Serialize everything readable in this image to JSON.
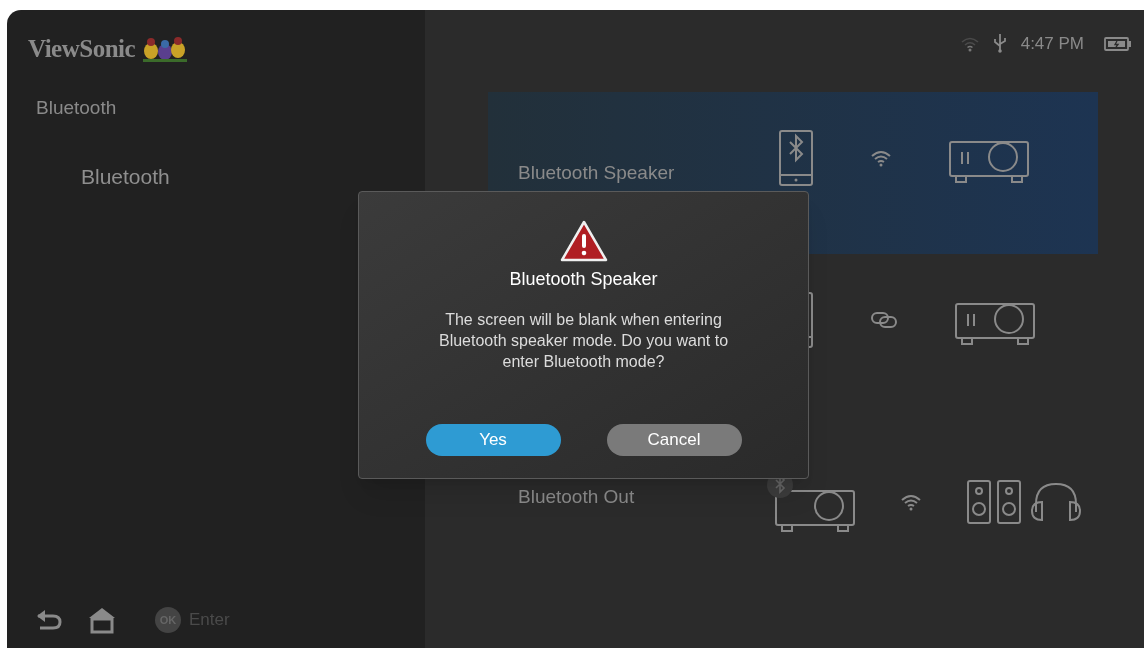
{
  "brand": {
    "name": "ViewSonic"
  },
  "sidebar": {
    "title": "Bluetooth",
    "items": [
      {
        "label": "Bluetooth",
        "selected": true
      }
    ]
  },
  "status_bar": {
    "time": "4:47 PM"
  },
  "options": [
    {
      "kind": "speaker",
      "label": "Bluetooth Speaker",
      "selected": true
    },
    {
      "kind": "pairing",
      "selected": false
    },
    {
      "kind": "out",
      "label": "Bluetooth Out",
      "selected": false
    }
  ],
  "hints": [
    {
      "kind": "back"
    },
    {
      "kind": "home"
    },
    {
      "kind": "ok",
      "badge": "OK",
      "label": "Enter"
    }
  ],
  "dialog": {
    "title": "Bluetooth Speaker",
    "message": "The screen will be blank when entering Bluetooth speaker mode. Do you want to enter Bluetooth mode?",
    "buttons": [
      {
        "label": "Yes",
        "selected": true
      },
      {
        "label": "Cancel",
        "selected": false
      }
    ]
  }
}
